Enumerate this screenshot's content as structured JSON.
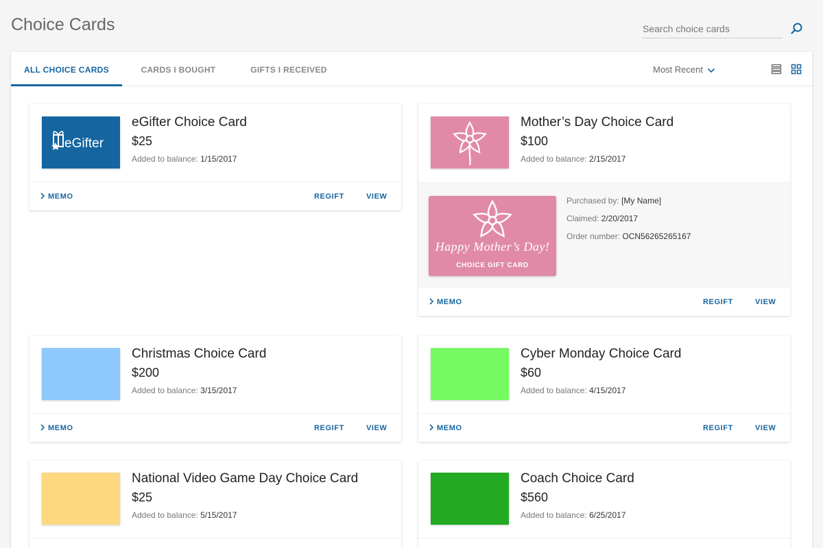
{
  "page": {
    "title": "Choice Cards"
  },
  "search": {
    "placeholder": "Search choice cards"
  },
  "tabs": [
    {
      "label": "ALL CHOICE CARDS",
      "active": true
    },
    {
      "label": "CARDS I BOUGHT",
      "active": false
    },
    {
      "label": "GIFTS I RECEIVED",
      "active": false
    }
  ],
  "sort": {
    "selected": "Most Recent"
  },
  "actions": {
    "memo": "MEMO",
    "regift": "REGIFT",
    "view": "VIEW"
  },
  "labels": {
    "added": "Added to balance:",
    "purchased_by": "Purchased by:",
    "claimed": "Claimed:",
    "order_number": "Order number:"
  },
  "cards": [
    {
      "name": "eGifter Choice Card",
      "amount": "$25",
      "added": "1/15/2017",
      "logo_text": "eGifter",
      "color": "#1565a0"
    },
    {
      "name": "Mother’s Day Choice Card",
      "amount": "$100",
      "added": "2/15/2017",
      "color": "#e08aa7"
    },
    {
      "name": "Christmas Choice Card",
      "amount": "$200",
      "added": "3/15/2017",
      "color": "#8fc8fc"
    },
    {
      "name": "Cyber Monday Choice Card",
      "amount": "$60",
      "added": "4/15/2017",
      "color": "#76fa62"
    },
    {
      "name": "National Video Game Day Choice Card",
      "amount": "$25",
      "added": "5/15/2017",
      "color": "#fdd881"
    },
    {
      "name": "Coach Choice Card",
      "amount": "$560",
      "added": "6/25/2017",
      "color": "#22aa22"
    }
  ],
  "expanded": {
    "purchased_by": "[My Name]",
    "claimed": "2/20/2017",
    "order_number": "OCN56265265167",
    "art_line1": "Happy Mother’s Day!",
    "art_line2": "CHOICE GIFT CARD"
  },
  "colors": {
    "accent": "#1565a0"
  },
  "icons": {
    "search": "search-icon",
    "list_view": "list-view-icon",
    "grid_view": "grid-view-icon",
    "chevron": "chevron-right-icon",
    "sort_caret": "chevron-down-icon"
  }
}
